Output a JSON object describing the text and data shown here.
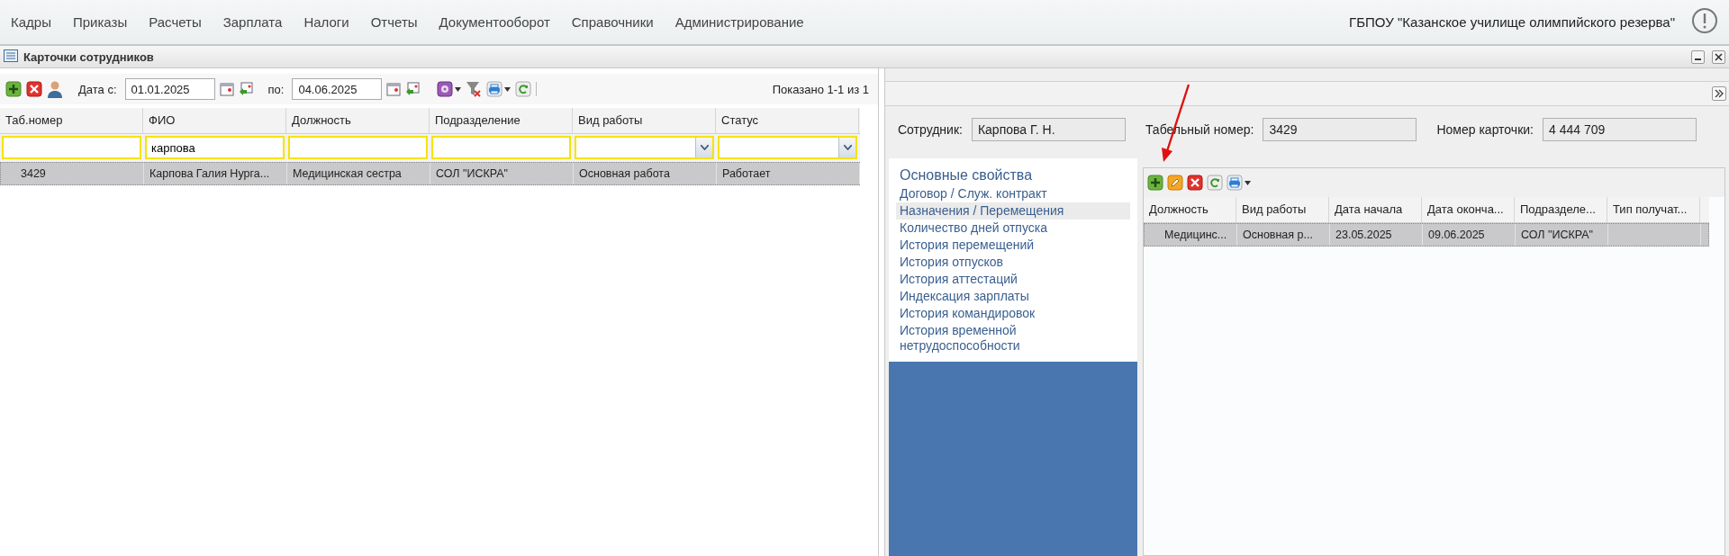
{
  "menu": [
    "Кадры",
    "Приказы",
    "Расчеты",
    "Зарплата",
    "Налоги",
    "Отчеты",
    "Документооборот",
    "Справочники",
    "Администрирование"
  ],
  "organization": "ГБПОУ \"Казанское училище олимпийского резерва\"",
  "panel": {
    "title": "Карточки сотрудников"
  },
  "toolbar": {
    "date_from_label": "Дата с:",
    "date_from": "01.01.2025",
    "date_to_label": "по:",
    "date_to": "04.06.2025",
    "shown": "Показано 1-1 из 1"
  },
  "employees": {
    "columns": [
      "Таб.номер",
      "ФИО",
      "Должность",
      "Подразделение",
      "Вид работы",
      "Статус"
    ],
    "filters": [
      {
        "kind": "text"
      },
      {
        "kind": "text",
        "value": "карпова"
      },
      {
        "kind": "text"
      },
      {
        "kind": "text"
      },
      {
        "kind": "select"
      },
      {
        "kind": "select"
      }
    ],
    "rows": [
      {
        "selected": true,
        "cells": [
          "3429",
          "Карпова Галия Нурга...",
          "Медицинская сестра",
          "СОЛ \"ИСКРА\"",
          "Основная работа",
          "Работает"
        ]
      }
    ]
  },
  "card": {
    "fields": [
      {
        "label": "Сотрудник:",
        "value": "Карпова Г. Н."
      },
      {
        "label": "Табельный номер:",
        "value": "3429"
      },
      {
        "label": "Номер карточки:",
        "value": "4 444 709"
      }
    ],
    "sections": [
      {
        "kind": "heading",
        "label": "Основные свойства",
        "selected": false
      },
      {
        "kind": "item",
        "label": "Договор / Служ. контракт",
        "selected": false
      },
      {
        "kind": "item",
        "label": "Назначения / Перемещения",
        "selected": true
      },
      {
        "kind": "item",
        "label": "Количество дней отпуска",
        "selected": false
      },
      {
        "kind": "item",
        "label": "История перемещений",
        "selected": false
      },
      {
        "kind": "item",
        "label": "История отпусков",
        "selected": false
      },
      {
        "kind": "item",
        "label": "История аттестаций",
        "selected": false
      },
      {
        "kind": "item",
        "label": "Индексация зарплаты",
        "selected": false
      },
      {
        "kind": "item",
        "label": "История командировок",
        "selected": false
      },
      {
        "kind": "item",
        "label": "История временной нетрудоспособности",
        "selected": false
      }
    ],
    "assignments": {
      "columns": [
        "Должность",
        "Вид работы",
        "Дата начала",
        "Дата оконча...",
        "Подразделе...",
        "Тип получат..."
      ],
      "rows": [
        {
          "selected": true,
          "cells": [
            "Медицинс...",
            "Основная р...",
            "23.05.2025",
            "09.06.2025",
            "СОЛ \"ИСКРА\"",
            ""
          ]
        }
      ]
    }
  }
}
